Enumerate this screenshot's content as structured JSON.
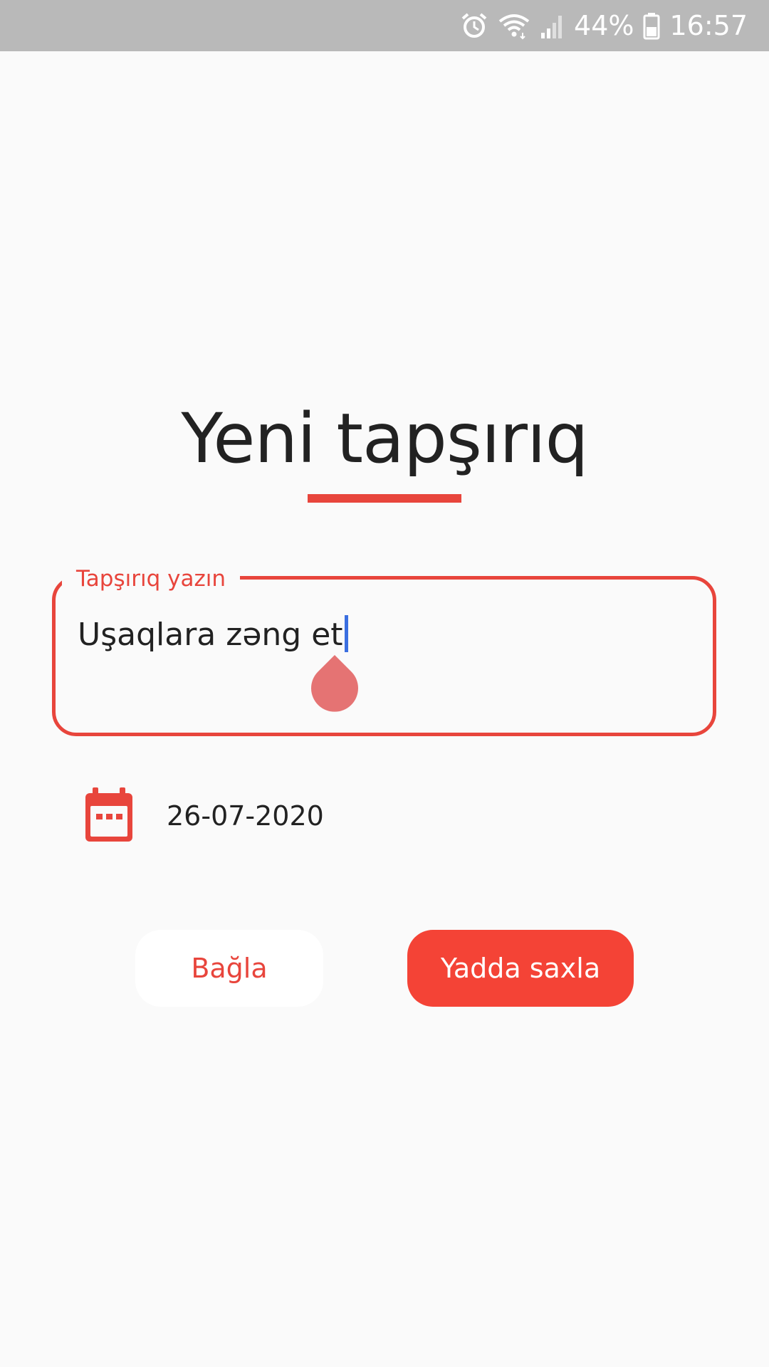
{
  "status_bar": {
    "battery_percent": "44%",
    "time": "16:57",
    "icons": [
      "alarm-icon",
      "wifi-icon",
      "signal-icon",
      "battery-icon"
    ]
  },
  "dialog": {
    "title": "Yeni tapşırıq",
    "input": {
      "label": "Tapşırıq yazın",
      "value": "Uşaqlara zəng et"
    },
    "date": {
      "icon": "calendar-icon",
      "value": "26-07-2020"
    },
    "buttons": {
      "close_label": "Bağla",
      "save_label": "Yadda saxla"
    }
  },
  "colors": {
    "accent": "#e8453c",
    "primary_button": "#f44336",
    "status_bar": "#b9b9b9",
    "background": "#fafafa",
    "caret": "#3b6fe0"
  }
}
